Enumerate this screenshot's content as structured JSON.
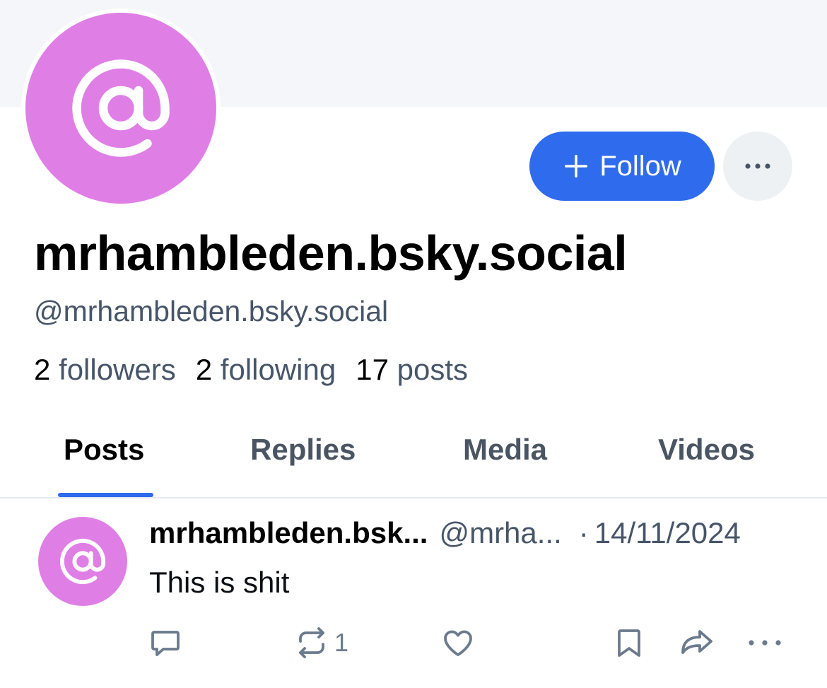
{
  "profile": {
    "display_name": "mrhambleden.bsky.social",
    "handle": "@mrhambleden.bsky.social",
    "avatar_icon": "at-sign-icon",
    "avatar_color": "#df7fe6",
    "stats": {
      "followers_count": "2",
      "followers_label": "followers",
      "following_count": "2",
      "following_label": "following",
      "posts_count": "17",
      "posts_label": "posts"
    }
  },
  "actions": {
    "follow_label": "Follow",
    "follow_icon": "plus-icon",
    "more_icon": "ellipsis-icon",
    "accent_color": "#2f6bed"
  },
  "tabs": [
    {
      "label": "Posts",
      "active": true
    },
    {
      "label": "Replies",
      "active": false
    },
    {
      "label": "Media",
      "active": false
    },
    {
      "label": "Videos",
      "active": false
    }
  ],
  "post": {
    "author": "mrhambleden.bsk...",
    "handle": "@mrha...",
    "separator": "·",
    "date": "14/11/2024",
    "text": "This is shit",
    "repost_count": "1",
    "action_icons": [
      "reply-icon",
      "repost-icon",
      "like-icon",
      "bookmark-icon",
      "share-icon",
      "more-icon"
    ]
  }
}
